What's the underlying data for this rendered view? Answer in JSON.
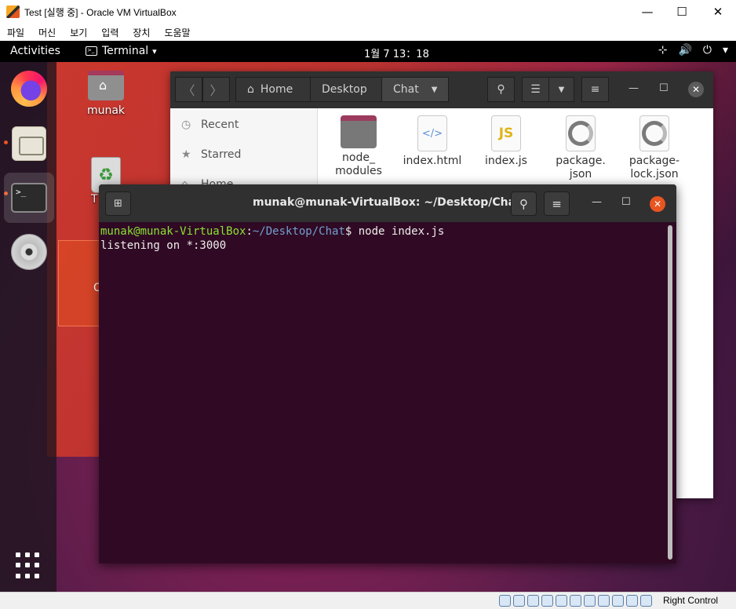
{
  "host": {
    "title": "Test [실행 중] - Oracle VM VirtualBox",
    "controls": {
      "minimize": "—",
      "maximize": "☐",
      "close": "✕"
    },
    "menu": [
      "파일",
      "머신",
      "보기",
      "입력",
      "장치",
      "도움말"
    ],
    "status_icons": [
      "hard-disk",
      "optical-drive",
      "audio",
      "network",
      "usb",
      "shared-folders",
      "display",
      "video-capture",
      "cpu",
      "host-key-indicator",
      "mouse-integration"
    ],
    "host_key": "Right Control"
  },
  "topbar": {
    "activities": "Activities",
    "app_menu": "Terminal",
    "app_menu_icon": ">_",
    "clock": "1월 7  13：18",
    "tray_icons": {
      "network": "⊹",
      "volume": "🔊",
      "power": "⏻",
      "dropdown": "▾"
    }
  },
  "dock": {
    "items": [
      "firefox",
      "files",
      "terminal",
      "optical-disc"
    ],
    "terminal_glyph": ">_"
  },
  "desktop": {
    "icons": {
      "home": "munak",
      "trash": "T",
      "selected": "C"
    }
  },
  "files": {
    "nav": {
      "back": "〈",
      "forward": "〉"
    },
    "breadcrumb": {
      "home": "Home",
      "desktop": "Desktop",
      "current": "Chat"
    },
    "sidebar": [
      {
        "label": "Recent",
        "icon": "◷"
      },
      {
        "label": "Starred",
        "icon": "★"
      },
      {
        "label": "Home",
        "icon": "⌂"
      }
    ],
    "items": [
      {
        "name": "node_\nmodules",
        "type": "folder",
        "icon_text": ""
      },
      {
        "name": "index.html",
        "type": "html",
        "icon_text": "</>"
      },
      {
        "name": "index.js",
        "type": "js",
        "icon_text": "JS"
      },
      {
        "name": "package.\njson",
        "type": "json",
        "icon_text": ""
      },
      {
        "name": "package-\nlock.json",
        "type": "json",
        "icon_text": ""
      }
    ]
  },
  "terminal": {
    "title": "munak@munak-VirtualBox: ~/Desktop/Chat",
    "prompt_user": "munak@munak-VirtualBox",
    "prompt_sep": ":",
    "prompt_path": "~/Desktop/Chat",
    "prompt_end": "$ ",
    "command": "node index.js",
    "output": "listening on *:3000"
  }
}
